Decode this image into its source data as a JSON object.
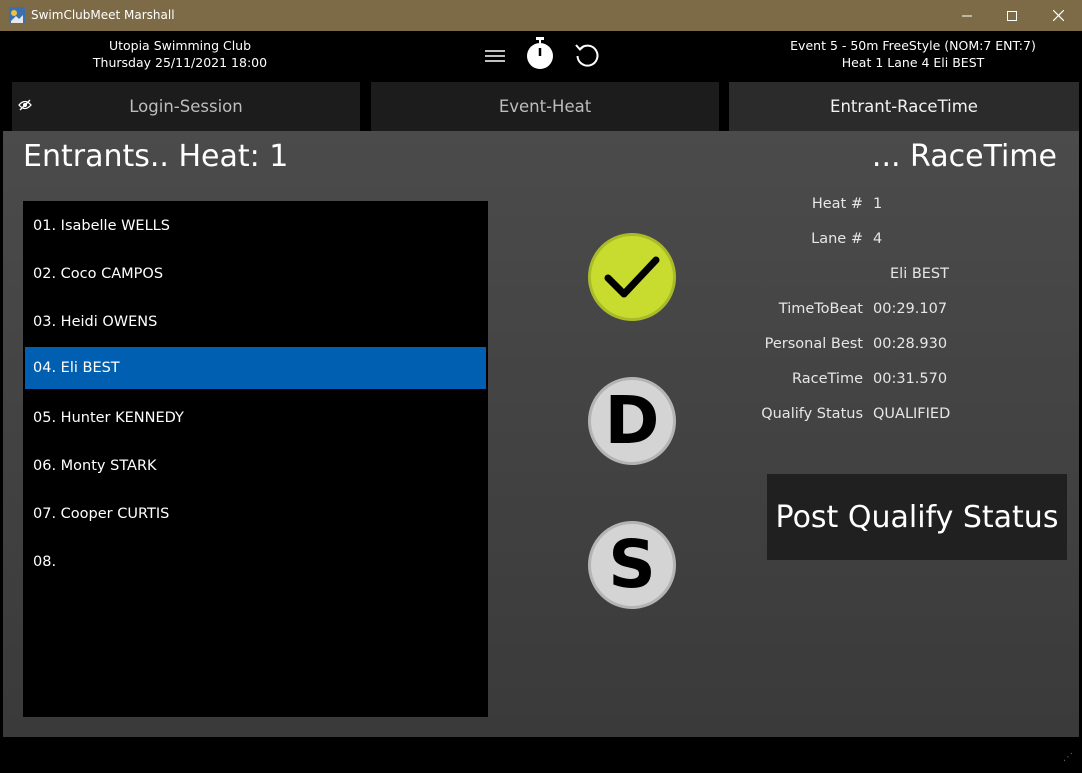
{
  "window": {
    "title": "SwimClubMeet Marshall"
  },
  "header": {
    "club_name": "Utopia Swimming Club",
    "session_datetime": "Thursday 25/11/2021 18:00",
    "event_line": "Event 5 - 50m FreeStyle (NOM:7 ENT:7)",
    "heat_line": "Heat 1  Lane 4  Eli BEST",
    "icons": [
      "hamburger-menu-icon",
      "stopwatch-icon",
      "refresh-icon"
    ]
  },
  "tabs": [
    {
      "label": "Login-Session",
      "icon": "hidden-eye-icon",
      "active": false
    },
    {
      "label": "Event-Heat",
      "active": false
    },
    {
      "label": "Entrant-RaceTime",
      "active": true
    }
  ],
  "entrants": {
    "heading": "Entrants.. Heat: 1",
    "rows": [
      "01. Isabelle WELLS",
      "02. Coco CAMPOS",
      "03. Heidi OWENS",
      "04. Eli BEST",
      "05. Hunter KENNEDY",
      "06. Monty STARK",
      "07. Cooper CURTIS",
      "08."
    ],
    "selected_index": 3
  },
  "actions": {
    "check_icon": "checkmark-icon",
    "dq_label": "D",
    "scratch_label": "S",
    "check_color": "#c8dc30",
    "dq_color": "#d4d4d4"
  },
  "racetime": {
    "heading": "... RaceTime",
    "fields": [
      {
        "label": "Heat #",
        "value": "1"
      },
      {
        "label": "Lane #",
        "value": "4"
      },
      {
        "label": "",
        "value": "Eli BEST"
      },
      {
        "label": "TimeToBeat",
        "value": "00:29.107"
      },
      {
        "label": "Personal Best",
        "value": "00:28.930"
      },
      {
        "label": "RaceTime",
        "value": "00:31.570"
      },
      {
        "label": "Qualify Status",
        "value": "QUALIFIED"
      }
    ],
    "post_button": "Post Qualify Status"
  },
  "colors": {
    "selected_row": "#005fb0",
    "titlebar": "#7d6b47"
  }
}
